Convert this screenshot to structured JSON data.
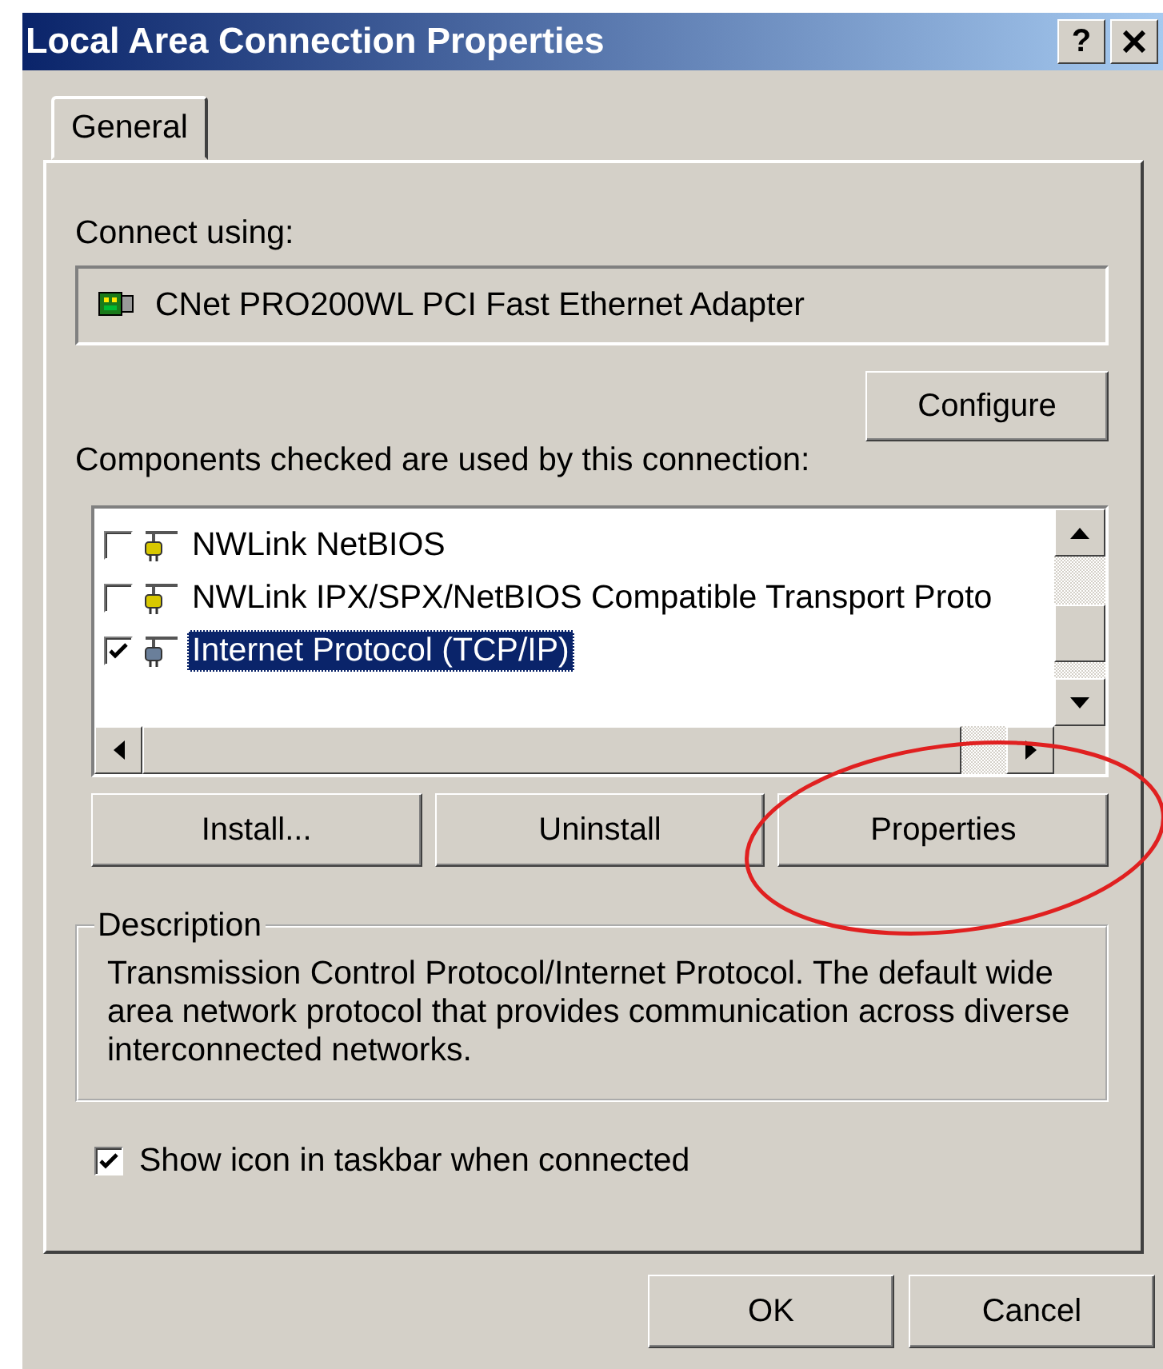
{
  "window": {
    "title": "Local Area Connection Properties",
    "help_button": "?"
  },
  "tabs": [
    {
      "label": "General",
      "selected": true
    }
  ],
  "connect_using": {
    "label": "Connect using:",
    "adapter": "CNet PRO200WL PCI Fast Ethernet Adapter",
    "configure_button": "Configure"
  },
  "components": {
    "label": "Components checked are used by this connection:",
    "items": [
      {
        "name": "NWLink NetBIOS",
        "checked": false,
        "selected": false
      },
      {
        "name": "NWLink IPX/SPX/NetBIOS Compatible Transport Proto",
        "checked": false,
        "selected": false
      },
      {
        "name": "Internet Protocol (TCP/IP)",
        "checked": true,
        "selected": true
      }
    ]
  },
  "component_buttons": [
    "Install...",
    "Uninstall",
    "Properties"
  ],
  "description": {
    "title": "Description",
    "text": "Transmission Control Protocol/Internet Protocol. The default wide area network protocol that provides communication across diverse interconnected networks."
  },
  "show_icon": {
    "label": "Show icon in taskbar when connected",
    "checked": true
  },
  "dialog_buttons": [
    "OK",
    "Cancel"
  ]
}
